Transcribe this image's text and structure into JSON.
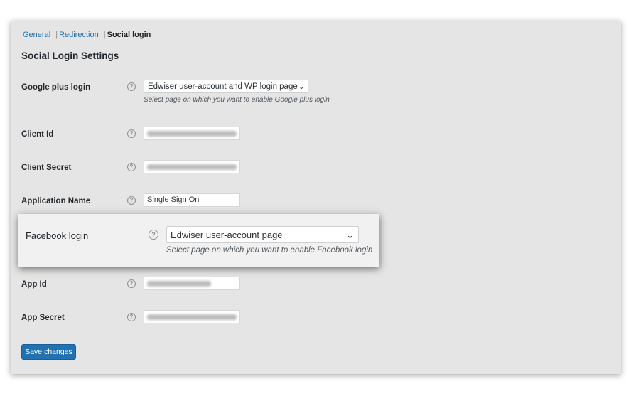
{
  "subnav": {
    "general": "General",
    "redirection": "Redirection",
    "social_login": "Social login",
    "separator": "|"
  },
  "page_title": "Social Login Settings",
  "google_plus_login": {
    "label": "Google plus login",
    "selected": "Edwiser user-account and WP login page",
    "description": "Select page on which you want to enable Google plus login"
  },
  "client_id": {
    "label": "Client Id"
  },
  "client_secret": {
    "label": "Client Secret"
  },
  "application_name": {
    "label": "Application Name",
    "value": "Single Sign On"
  },
  "facebook_login": {
    "label": "Facebook login",
    "selected": "Edwiser user-account page",
    "description": "Select page on which you want to enable Facebook login"
  },
  "app_id": {
    "label": "App Id"
  },
  "app_secret": {
    "label": "App Secret"
  },
  "save_button": {
    "label": "Save changes"
  },
  "icons": {
    "help": "?",
    "chevron": "⌄"
  },
  "colors": {
    "accent": "#2271b1",
    "panel": "#e5e5e5"
  }
}
